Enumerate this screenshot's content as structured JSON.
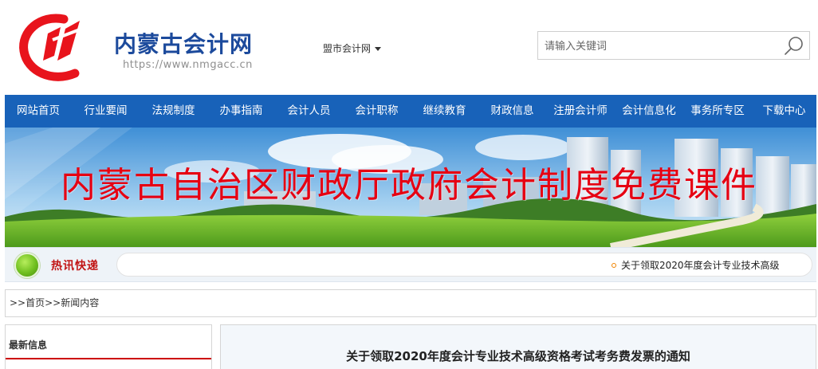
{
  "header": {
    "site_name": "内蒙古会计网",
    "site_url": "https://www.nmgacc.cn",
    "city_select": "盟市会计网",
    "search_placeholder": "请输入关键词"
  },
  "nav": {
    "items": [
      "网站首页",
      "行业要闻",
      "法规制度",
      "办事指南",
      "会计人员",
      "会计职称",
      "继续教育",
      "财政信息",
      "注册会计师",
      "会计信息化",
      "事务所专区",
      "下载中心"
    ]
  },
  "banner": {
    "text": "内蒙古自治区财政厅政府会计制度免费课件"
  },
  "hot_news": {
    "label": "热讯快递",
    "items": [
      "关于领取2020年度会计专业技术高级"
    ]
  },
  "breadcrumb": ">>首页>>新闻内容",
  "sidebar": {
    "title": "最新信息"
  },
  "article": {
    "title": "关于领取2020年度会计专业技术高级资格考试考务费发票的通知"
  },
  "colors": {
    "nav_bg": "#1862b9",
    "brand_blue": "#1c4a9c",
    "banner_red": "#e60012",
    "logo_red": "#e8141c"
  }
}
